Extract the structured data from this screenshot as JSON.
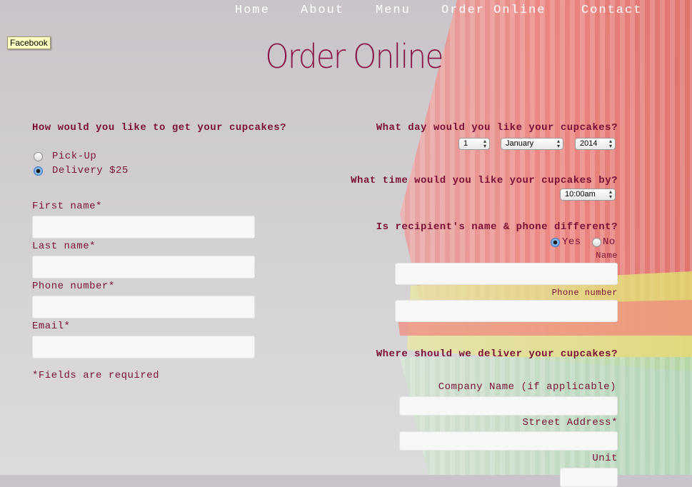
{
  "nav": {
    "items": [
      "Home",
      "About",
      "Menu",
      "Order Online",
      "Contact"
    ]
  },
  "tooltip": "Facebook",
  "page_title": "Order Online",
  "pickup": {
    "question": "How would you like to get your cupcakes?",
    "options": [
      {
        "label": "Pick-Up",
        "selected": false
      },
      {
        "label": "Delivery $25",
        "selected": true
      }
    ]
  },
  "contact": {
    "first_name_label": "First name*",
    "last_name_label": "Last name*",
    "phone_label": "Phone number*",
    "email_label": "Email*",
    "required_note": "*Fields are required"
  },
  "date": {
    "question": "What day would you like your cupcakes?",
    "day": "1",
    "month": "January",
    "year": "2014"
  },
  "time": {
    "question": "What time would you like your cupcakes by?",
    "value": "10:00am"
  },
  "recipient": {
    "question": "Is recipient's name & phone different?",
    "yes_label": "Yes",
    "no_label": "No",
    "yes_selected": true,
    "name_label": "Name",
    "phone_label": "Phone number"
  },
  "delivery": {
    "question": "Where should we deliver your cupcakes?",
    "company_label": "Company Name (if applicable)",
    "street_label": "Street Address*",
    "unit_label": "Unit"
  }
}
